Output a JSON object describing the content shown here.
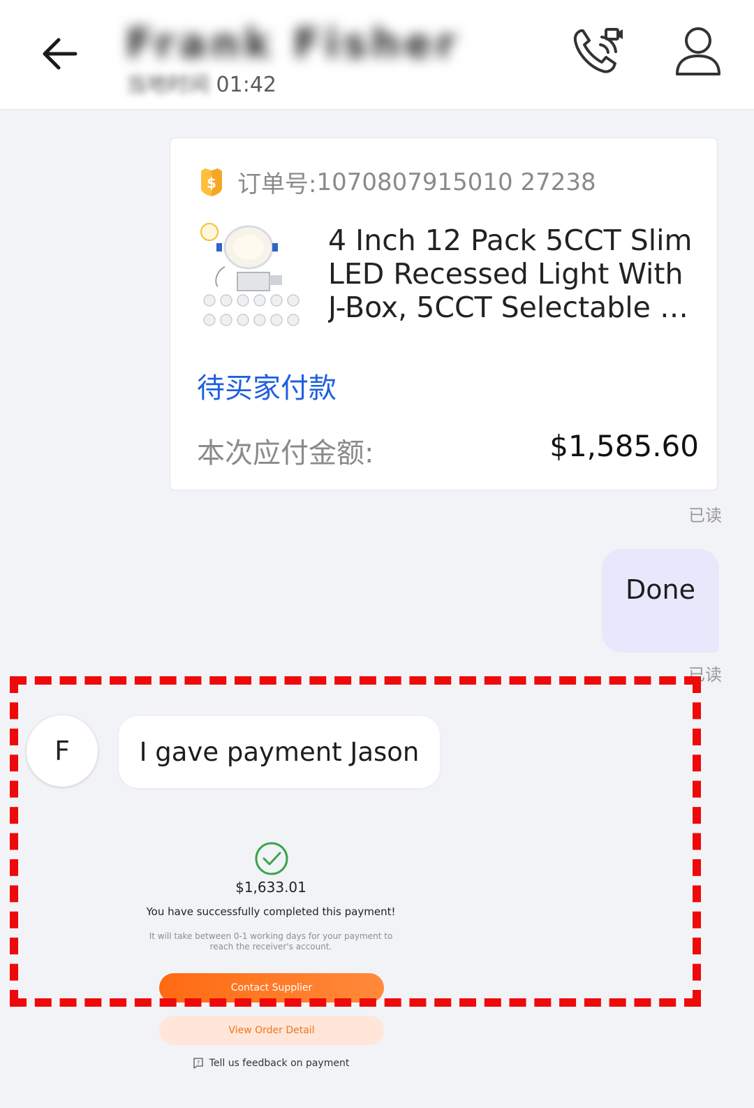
{
  "header": {
    "contact_name": "Frank Fisher",
    "local_time_label": "当地时间",
    "local_time_value": "01:42"
  },
  "order_card": {
    "order_no_label": "订单号:",
    "order_no_value": "1070807915010 27238",
    "product_title": "4 Inch 12 Pack 5CCT Slim LED Recessed Light With J-Box, 5CCT Selectable …",
    "status": "待买家付款",
    "amount_label": "本次应付金额:",
    "amount_value": "$1,585.60",
    "read_status": "已读"
  },
  "outgoing_message": {
    "text": "Done",
    "read_status": "已读"
  },
  "incoming_message": {
    "avatar_initial": "F",
    "text": "I gave payment Jason"
  },
  "payment_screenshot": {
    "amount": "$1,633.01",
    "success_text": "You have successfully completed this payment!",
    "note": "It will take between 0-1 working days for your payment to reach the receiver's account.",
    "primary_button": "Contact Supplier",
    "secondary_button": "View Order Detail",
    "feedback_link": "Tell us feedback on payment"
  },
  "colors": {
    "accent_blue": "#1e5fe0",
    "annotation_red": "#ee0a0a",
    "orange": "#ff6a13",
    "success_green": "#3aa44a",
    "bubble_lavender": "#e7e8fb"
  }
}
